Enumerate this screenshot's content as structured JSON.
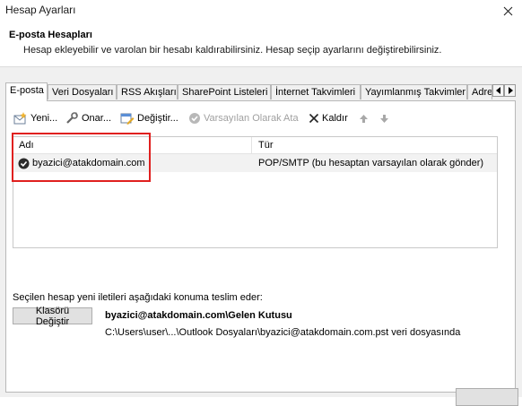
{
  "window": {
    "title": "Hesap Ayarları"
  },
  "header": {
    "title": "E-posta Hesapları",
    "description": "Hesap ekleyebilir ve varolan bir hesabı kaldırabilirsiniz. Hesap seçip ayarlarını değiştirebilirsiniz."
  },
  "tabs": [
    {
      "label": "E-posta",
      "active": true
    },
    {
      "label": "Veri Dosyaları"
    },
    {
      "label": "RSS Akışları"
    },
    {
      "label": "SharePoint Listeleri"
    },
    {
      "label": "İnternet Takvimleri"
    },
    {
      "label": "Yayımlanmış Takvimler"
    },
    {
      "label": "Adres"
    }
  ],
  "toolbar": {
    "new_label": "Yeni...",
    "repair_label": "Onar...",
    "change_label": "Değiştir...",
    "set_default_label": "Varsayılan Olarak Ata",
    "remove_label": "Kaldır"
  },
  "accounts": {
    "columns": {
      "name": "Adı",
      "type": "Tür"
    },
    "rows": [
      {
        "name": "byazici@atakdomain.com",
        "type": "POP/SMTP (bu hesaptan varsayılan olarak gönder)"
      }
    ]
  },
  "delivery": {
    "label": "Seçilen hesap yeni iletileri aşağıdaki konuma teslim eder:",
    "change_folder_label": "Klasörü Değiştir",
    "inbox_path": "byazici@atakdomain.com\\Gelen Kutusu",
    "file_path": "C:\\Users\\user\\...\\Outlook Dosyaları\\byazici@atakdomain.com.pst veri dosyasında"
  },
  "colors": {
    "highlight": "#e0201f",
    "accent": "#3a78c9"
  }
}
